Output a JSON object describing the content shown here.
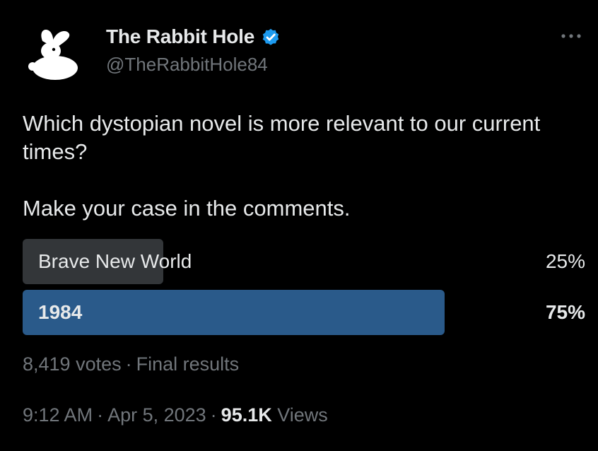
{
  "author": {
    "name": "The Rabbit Hole",
    "handle": "@TheRabbitHole84",
    "verified": true,
    "avatar_icon": "rabbit-icon",
    "verified_color": "#1d9bf0"
  },
  "more_icon": "more-horizontal-icon",
  "tweet": {
    "text": "Which dystopian novel is more relevant to our current times?\n\nMake your case in the comments."
  },
  "poll": {
    "options": [
      {
        "label": "Brave New World",
        "percent_text": "25%",
        "percent": 25,
        "winner": false,
        "bar_color": "#333639"
      },
      {
        "label": "1984",
        "percent_text": "75%",
        "percent": 75,
        "winner": true,
        "bar_color": "#2a5a8a"
      }
    ],
    "votes": "8,419 votes",
    "separator": "·",
    "status": "Final results"
  },
  "meta": {
    "time": "9:12 AM",
    "date": "Apr 5, 2023",
    "views_count": "95.1K",
    "views_label": "Views",
    "separator": "·"
  }
}
